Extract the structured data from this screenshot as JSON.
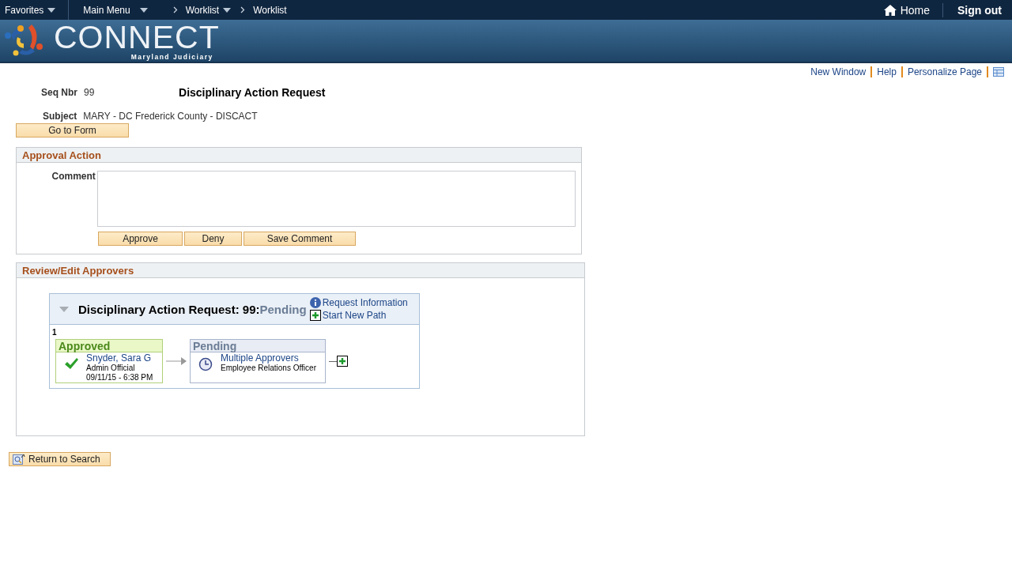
{
  "nav": {
    "favorites": "Favorites",
    "main_menu": "Main Menu",
    "breadcrumbs": [
      {
        "label": "Worklist",
        "dropdown": true
      },
      {
        "label": "Worklist",
        "dropdown": false
      }
    ],
    "home": "Home",
    "sign_out": "Sign out"
  },
  "brand": {
    "name": "CONNECT",
    "subtitle": "Maryland Judiciary"
  },
  "page_links": [
    "New Window",
    "Help",
    "Personalize Page"
  ],
  "header": {
    "seq_label": "Seq Nbr",
    "seq_value": "99",
    "title": "Disciplinary Action Request",
    "subject_label": "Subject",
    "subject_value": "MARY - DC Frederick County - DISCACT",
    "go_button": "Go to Form"
  },
  "approval": {
    "title": "Approval Action",
    "comment_label": "Comment",
    "buttons": [
      "Approve",
      "Deny",
      "Save Comment"
    ]
  },
  "review": {
    "title": "Review/Edit Approvers",
    "path_title": "Disciplinary Action Request: 99:",
    "path_status": "Pending",
    "request_info": "Request Information",
    "start_new_path": "Start New Path",
    "step": "1",
    "stages": [
      {
        "kind": "approved",
        "label": "Approved",
        "name": "Snyder, Sara G",
        "role": "Admin Official",
        "date": "09/11/15 - 6:38 PM"
      },
      {
        "kind": "pending",
        "label": "Pending",
        "name": "Multiple Approvers",
        "role": "Employee Relations Officer"
      }
    ]
  },
  "return_button": "Return to Search"
}
